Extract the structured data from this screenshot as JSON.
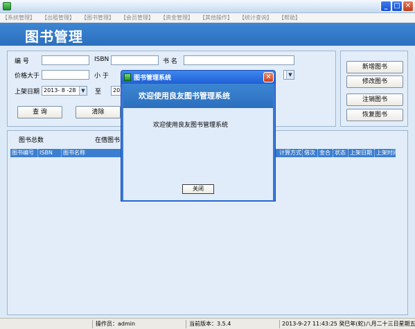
{
  "window": {
    "min_glyph": "_",
    "max_glyph": "□",
    "close_glyph": "✕"
  },
  "menu": [
    "【系统管理】",
    "【出租管理】",
    "【图书管理】",
    "【会员管理】",
    "【资金管理】",
    "【其他操作】",
    "【统计查询】",
    "【帮助】"
  ],
  "banner": {
    "title": "图书管理"
  },
  "search": {
    "id_label": "编  号",
    "id_value": "",
    "isbn_label": "ISBN",
    "isbn_value": "",
    "name_label": "书  名",
    "name_value": "",
    "price_gt_label": "价格大于",
    "price_gt_value": "",
    "price_lt_label": "小 于",
    "date_label": "上架日期",
    "date_from": "2013- 8 -28",
    "date_to_label": "至",
    "date_to": "201",
    "query_button": "查 询",
    "clear_button": "清除"
  },
  "actions": {
    "add_button": "新增图书",
    "edit_button": "修改图书",
    "remove_button": "注销图书",
    "restore_button": "恢复图书"
  },
  "results": {
    "total_label": "图书总数",
    "borrowed_label": "在借图书",
    "columns": [
      "图书编号",
      "ISBN",
      "图书名称",
      "计算方式",
      "借次",
      "金合",
      "状态",
      "上架日期",
      "上架时间"
    ]
  },
  "status": {
    "operator": "操作员：admin",
    "version": "当前版本：3.5.4",
    "datetime": "2013-9-27 11:43:25 癸巳年(蛇)八月二十三日星期五"
  },
  "dialog": {
    "title": "图书管理系统",
    "heading": "欢迎使用良友图书管理系统",
    "message": "欢迎使用良友图书管理系统",
    "close_button": "关闭",
    "close_glyph": "✕"
  }
}
